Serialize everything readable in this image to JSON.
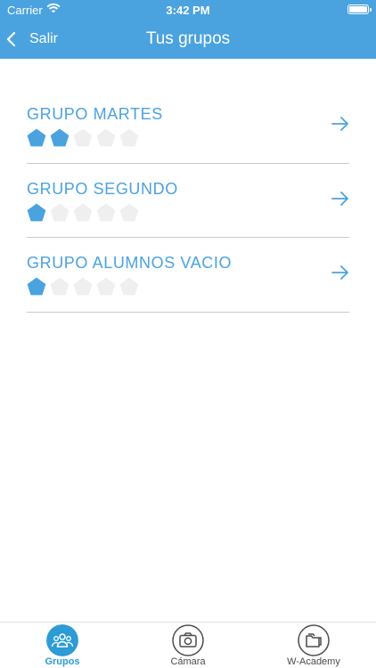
{
  "status_bar": {
    "carrier": "Carrier",
    "time": "3:42 PM"
  },
  "nav": {
    "back_label": "Salir",
    "title": "Tus grupos"
  },
  "groups": [
    {
      "name": "GRUPO MARTES",
      "level": 2,
      "max_level": 5
    },
    {
      "name": "GRUPO SEGUNDO",
      "level": 1,
      "max_level": 5
    },
    {
      "name": "GRUPO ALUMNOS VACIO",
      "level": 1,
      "max_level": 5
    }
  ],
  "tabs": [
    {
      "label": "Grupos",
      "icon": "groups-icon",
      "active": true
    },
    {
      "label": "Cámara",
      "icon": "camera-icon",
      "active": false
    },
    {
      "label": "W-Academy",
      "icon": "folder-icon",
      "active": false
    }
  ],
  "colors": {
    "accent": "#4aa3df",
    "pentagon_on": "#4aa3df",
    "pentagon_off": "#efefef",
    "tab_active": "#2c9bd6"
  }
}
